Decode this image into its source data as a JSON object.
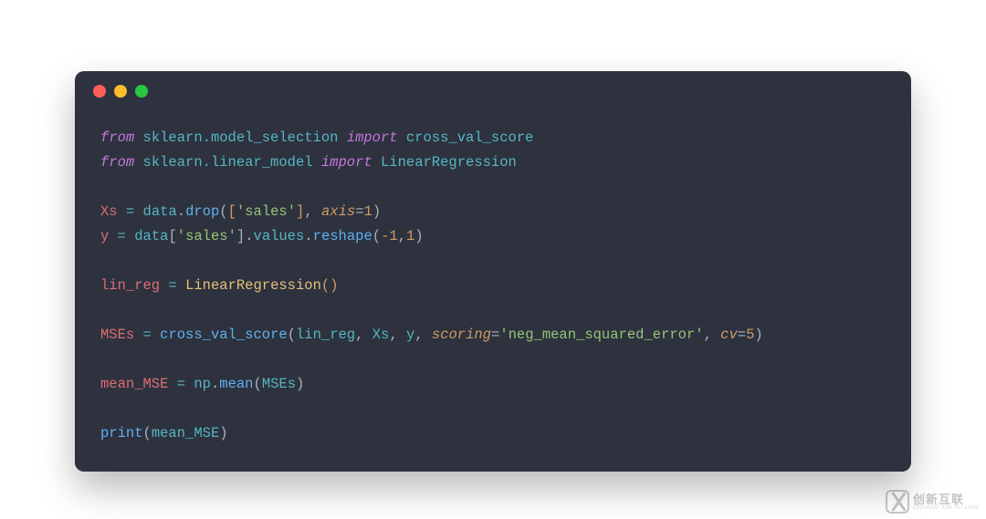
{
  "code": {
    "kw_from": "from",
    "kw_import": "import",
    "mod1": "sklearn.model_selection",
    "imp1": "cross_val_score",
    "mod2": "sklearn.linear_model",
    "imp2": "LinearRegression",
    "Xs": "Xs",
    "y": "y",
    "data": "data",
    "drop": "drop",
    "sales": "'sales'",
    "axis": "axis",
    "one": "1",
    "neg1": "-1",
    "values": "values",
    "reshape": "reshape",
    "lin_reg": "lin_reg",
    "LinearRegression": "LinearRegression",
    "MSEs": "MSEs",
    "cross_val_score": "cross_val_score",
    "scoring": "scoring",
    "neg_mse": "'neg_mean_squared_error'",
    "cv": "cv",
    "five": "5",
    "mean_MSE": "mean_MSE",
    "np": "np",
    "mean": "mean",
    "print": "print"
  },
  "watermark": {
    "cn": "创新互联",
    "py": "CHUANG XIN HU LIAN"
  }
}
